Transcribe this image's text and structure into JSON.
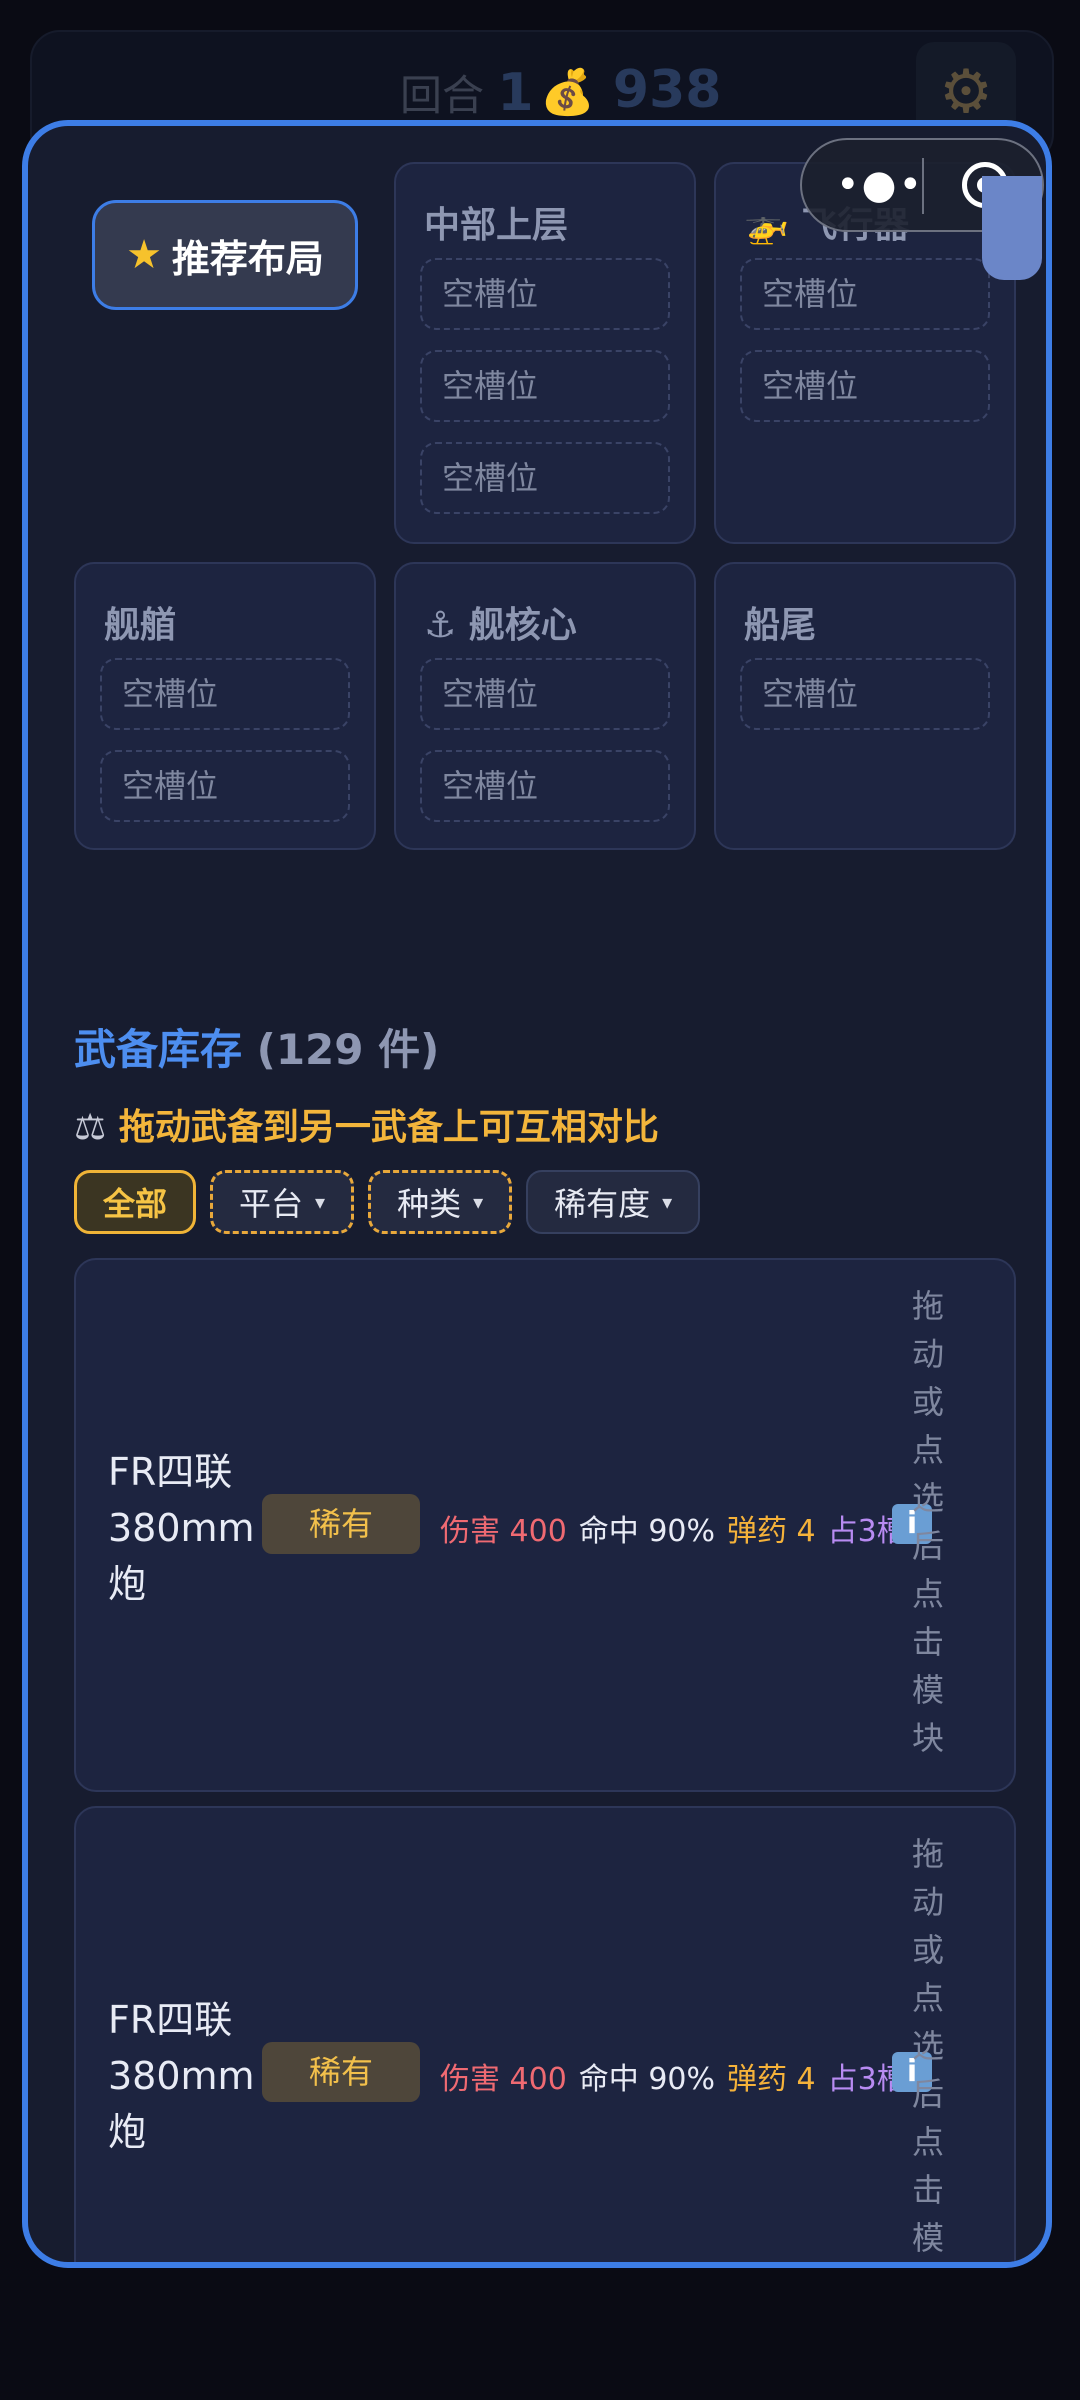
{
  "header": {
    "round_label": "回合",
    "round_value": "1",
    "gold_value": "938",
    "gold_icon": "moneybag-icon",
    "settings_icon": "gear-icon"
  },
  "layout": {
    "recommend_button": {
      "icon": "star-icon",
      "label": "推荐布局"
    },
    "sections": [
      {
        "key": "mid-upper",
        "title": "中部上层",
        "slots": [
          "空槽位",
          "空槽位",
          "空槽位"
        ]
      },
      {
        "key": "aircraft",
        "title": "🚁 飞行器",
        "slots": [
          "空槽位",
          "空槽位"
        ]
      },
      {
        "key": "bow",
        "title": "舰艏",
        "slots": [
          "空槽位",
          "空槽位"
        ]
      },
      {
        "key": "core",
        "title": "⚓ 舰核心",
        "slots": [
          "空槽位",
          "空槽位"
        ]
      },
      {
        "key": "stern",
        "title": "船尾",
        "slots": [
          "空槽位"
        ]
      }
    ]
  },
  "inventory": {
    "title": "武备库存",
    "count": "(129 件)",
    "tip": "拖动武备到另一武备上可互相对比",
    "tip_icon": "scale-icon",
    "filters": [
      {
        "label": "全部",
        "style": "active"
      },
      {
        "label": "平台",
        "style": "dashed",
        "caret": "▾"
      },
      {
        "label": "种类",
        "style": "dashed",
        "caret": "▾"
      },
      {
        "label": "稀有度",
        "style": "plain",
        "caret": "▾"
      }
    ],
    "items": [
      {
        "name": "FR四联380mm炮",
        "rarity": "稀有",
        "damage": "伤害 400",
        "hit": "命中 90%",
        "ammo": "弹药 4",
        "slots": "占3槽",
        "hint": "拖动或点选后点击模块"
      },
      {
        "name": "FR四联380mm炮",
        "rarity": "稀有",
        "damage": "伤害 400",
        "hit": "命中 90%",
        "ammo": "弹药 4",
        "slots": "占3槽",
        "hint": "拖动或点选后点击模块"
      }
    ]
  },
  "capsule": {
    "more_icon": "more-dots-icon",
    "close_icon": "target-close-icon"
  }
}
